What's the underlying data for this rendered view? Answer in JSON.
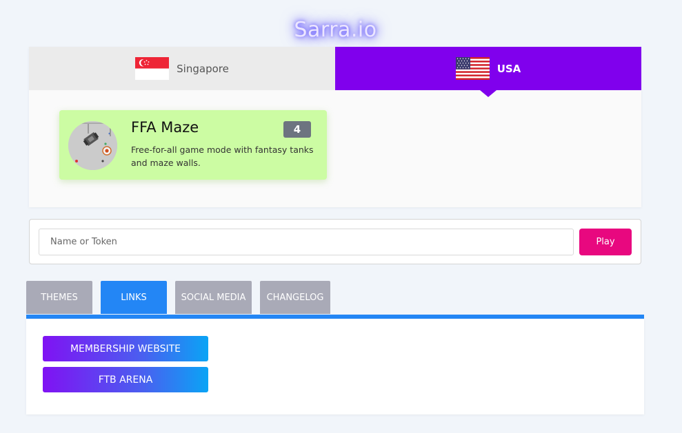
{
  "logo": "Sarra.io",
  "servers": [
    {
      "label": "Singapore",
      "flag": "singapore-flag-icon",
      "active": false
    },
    {
      "label": "USA",
      "flag": "usa-flag-icon",
      "active": true
    }
  ],
  "mode": {
    "title": "FFA Maze",
    "count": "4",
    "description": "Free-for-all game mode with fantasy tanks and maze walls."
  },
  "join": {
    "placeholder": "Name or Token",
    "value": "",
    "play_label": "Play"
  },
  "info_tabs": [
    {
      "label": "THEMES",
      "active": false
    },
    {
      "label": "LINKS",
      "active": true
    },
    {
      "label": "SOCIAL MEDIA",
      "active": false
    },
    {
      "label": "CHANGELOG",
      "active": false
    }
  ],
  "links": [
    {
      "label": "MEMBERSHIP WEBSITE"
    },
    {
      "label": "FTB ARENA"
    }
  ],
  "colors": {
    "server_active": "#8000ed",
    "mode_card": "#ccfca3",
    "play_button": "#e8087f",
    "tab_active": "#2386f5",
    "tab_inactive": "#a9aab7"
  }
}
